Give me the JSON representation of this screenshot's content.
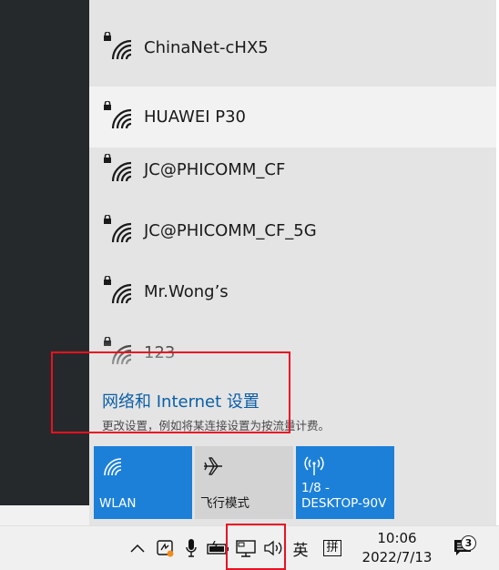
{
  "networks": [
    {
      "name": "ChinaNet-cHX5",
      "secured": true
    },
    {
      "name": "HUAWEI P30",
      "secured": true
    },
    {
      "name": "JC@PHICOMM_CF",
      "secured": true
    },
    {
      "name": "JC@PHICOMM_CF_5G",
      "secured": true
    },
    {
      "name": "Mr.Wong’s",
      "secured": true
    },
    {
      "name": "123",
      "secured": true
    }
  ],
  "settings": {
    "link": "网络和 Internet 设置",
    "description": "更改设置，例如将某连接设置为按流量计费。"
  },
  "quick_actions": [
    {
      "label": "WLAN",
      "icon": "wifi-icon",
      "state": "on"
    },
    {
      "label": "飞行模式",
      "icon": "airplane-icon",
      "state": "off"
    },
    {
      "label": "1/8 -\nDESKTOP-90V",
      "icon": "mobile-hotspot-icon",
      "state": "on"
    }
  ],
  "taskbar": {
    "ime_lang": "英",
    "ime_mode": "拼",
    "time": "10:06",
    "date": "2022/7/13",
    "notification_count": "3"
  },
  "colors": {
    "accent": "#1c80d8",
    "link": "#0a5ea8",
    "highlight_box": "#e81123"
  }
}
